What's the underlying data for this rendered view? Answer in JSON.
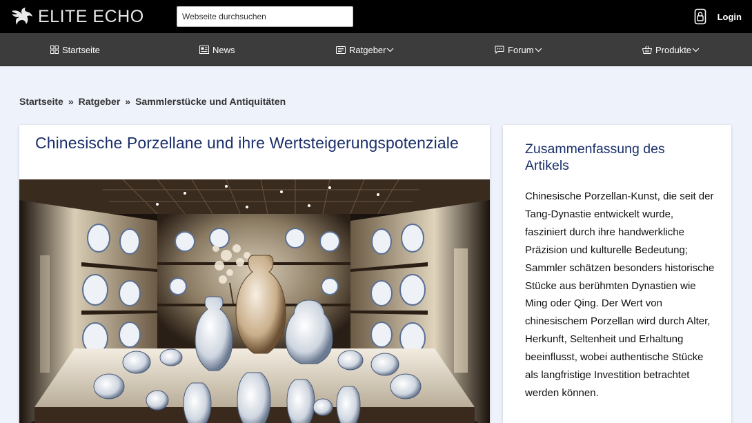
{
  "header": {
    "logo_text": "ELITE ECHO",
    "search_placeholder": "Webseite durchsuchen",
    "login_label": "Login"
  },
  "nav": {
    "items": [
      {
        "label": "Startseite",
        "icon": "grid-icon",
        "dropdown": false
      },
      {
        "label": "News",
        "icon": "newspaper-icon",
        "dropdown": false
      },
      {
        "label": "Ratgeber",
        "icon": "document-icon",
        "dropdown": true
      },
      {
        "label": "Forum",
        "icon": "chat-icon",
        "dropdown": true
      },
      {
        "label": "Produkte",
        "icon": "basket-icon",
        "dropdown": true
      }
    ]
  },
  "breadcrumb": {
    "items": [
      "Startseite",
      "Ratgeber",
      "Sammlerstücke und Antiquitäten"
    ],
    "separator": "»"
  },
  "article": {
    "title": "Chinesische Porzellane und ihre Wertsteigerungspotenziale"
  },
  "summary": {
    "title": "Zusammenfassung des Artikels",
    "text": "Chinesische Porzellan-Kunst, die seit der Tang-Dynastie entwickelt wurde, fasziniert durch ihre handwerkliche Präzision und kulturelle Bedeutung; Sammler schätzen besonders historische Stücke aus berühmten Dynastien wie Ming oder Qing. Der Wert von chinesischem Porzellan wird durch Alter, Herkunft, Seltenheit und Erhaltung beeinflusst, wobei authentische Stücke als langfristige Investition betrachtet werden können."
  },
  "colors": {
    "topbar": "#000000",
    "navbar": "#3c3c3c",
    "page_bg": "#eef2fa",
    "title_blue": "#1a2f6b"
  }
}
